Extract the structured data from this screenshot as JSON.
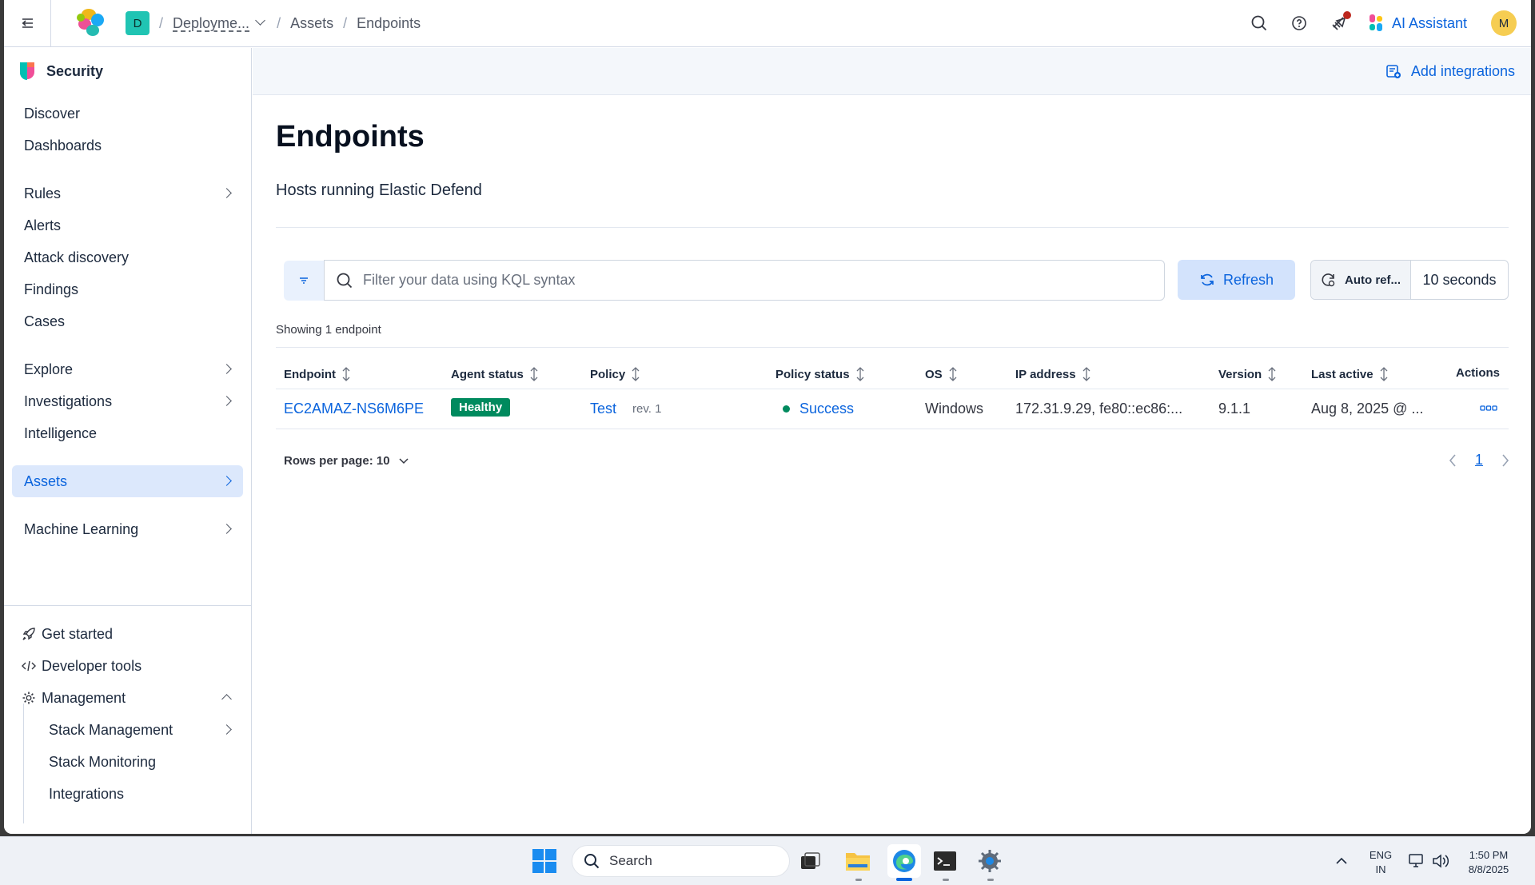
{
  "header": {
    "space_initial": "D",
    "breadcrumbs": [
      "Deployme...",
      "Assets",
      "Endpoints"
    ],
    "ai_assistant_label": "AI Assistant",
    "avatar_initial": "M"
  },
  "sidebar": {
    "app_title": "Security",
    "items": [
      {
        "label": "Discover"
      },
      {
        "label": "Dashboards"
      },
      {
        "label": "Rules"
      },
      {
        "label": "Alerts"
      },
      {
        "label": "Attack discovery"
      },
      {
        "label": "Findings"
      },
      {
        "label": "Cases"
      },
      {
        "label": "Explore"
      },
      {
        "label": "Investigations"
      },
      {
        "label": "Intelligence"
      },
      {
        "label": "Assets"
      },
      {
        "label": "Machine Learning"
      }
    ],
    "footer": [
      {
        "label": "Get started"
      },
      {
        "label": "Developer tools"
      },
      {
        "label": "Management"
      },
      {
        "label": "Stack Management"
      },
      {
        "label": "Stack Monitoring"
      },
      {
        "label": "Integrations"
      }
    ]
  },
  "content": {
    "add_integrations_label": "Add integrations",
    "title": "Endpoints",
    "subtitle": "Hosts running Elastic Defend",
    "search_placeholder": "Filter your data using KQL syntax",
    "refresh_label": "Refresh",
    "auto_refresh_label": "Auto ref...",
    "auto_refresh_interval": "10 seconds",
    "showing_text": "Showing 1 endpoint",
    "table": {
      "headers": [
        "Endpoint",
        "Agent status",
        "Policy",
        "Policy status",
        "OS",
        "IP address",
        "Version",
        "Last active",
        "Actions"
      ],
      "rows": [
        {
          "endpoint": "EC2AMAZ-NS6M6PE",
          "agent_status": "Healthy",
          "policy": "Test",
          "policy_rev": "rev. 1",
          "policy_status": "Success",
          "os": "Windows",
          "ip": "172.31.9.29, fe80::ec86:...",
          "version": "9.1.1",
          "last_active": "Aug 8, 2025 @ ..."
        }
      ]
    },
    "rows_per_page": "Rows per page: 10",
    "current_page": "1"
  },
  "taskbar": {
    "search_label": "Search",
    "lang_line1": "ENG",
    "lang_line2": "IN",
    "time": "1:50 PM",
    "date": "8/8/2025"
  },
  "colors": {
    "accent": "#0b64dd",
    "healthy": "#008a5e",
    "active_nav_bg": "#dce8fc"
  }
}
